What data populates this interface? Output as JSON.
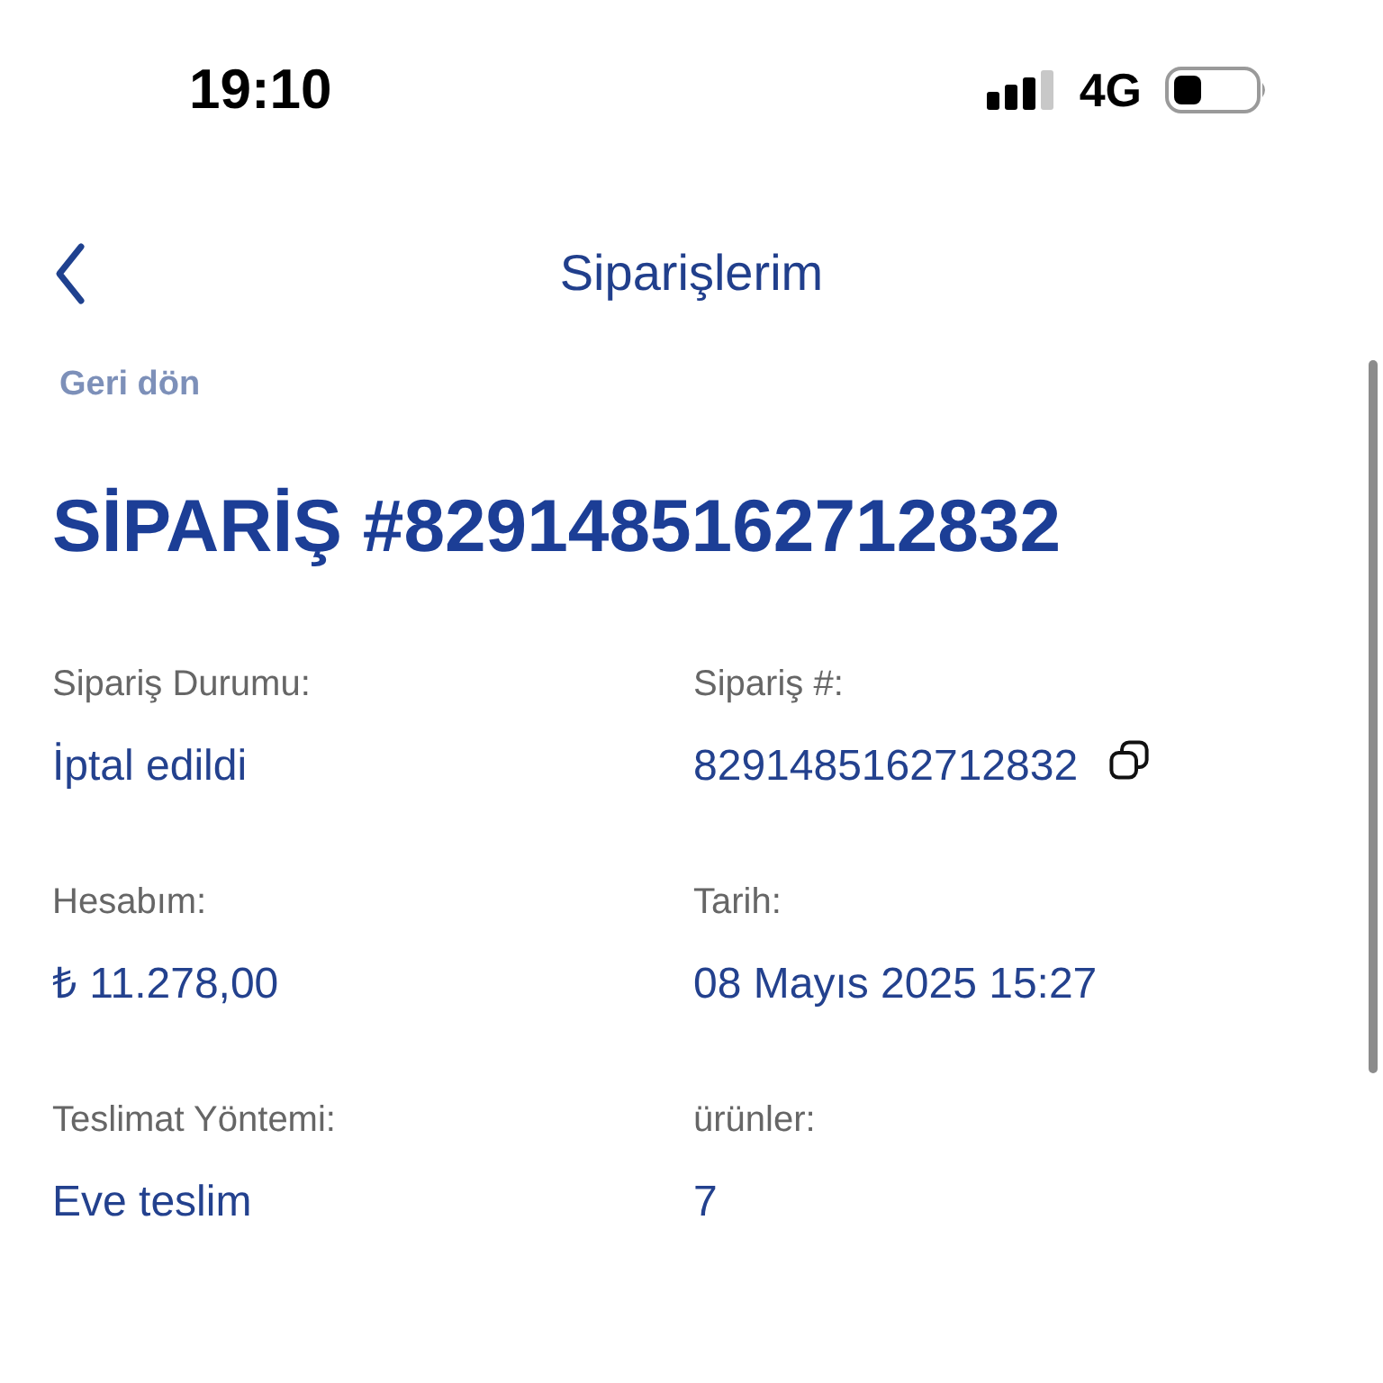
{
  "status_bar": {
    "time": "19:10",
    "network": "4G"
  },
  "nav": {
    "title": "Siparişlerim",
    "back_label": "Geri dön"
  },
  "order": {
    "heading": "SİPARİŞ #8291485162712832",
    "fields": [
      {
        "label": "Sipariş Durumu:",
        "value": "İptal edildi",
        "copyable": false
      },
      {
        "label": "Sipariş #:",
        "value": "8291485162712832",
        "copyable": true
      },
      {
        "label": "Hesabım:",
        "value": "₺ 11.278,00",
        "copyable": false
      },
      {
        "label": "Tarih:",
        "value": "08 Mayıs 2025 15:27",
        "copyable": false
      },
      {
        "label": "Teslimat Yöntemi:",
        "value": "Eve teslim",
        "copyable": false
      },
      {
        "label": "ürünler:",
        "value": "7",
        "copyable": false
      }
    ]
  }
}
